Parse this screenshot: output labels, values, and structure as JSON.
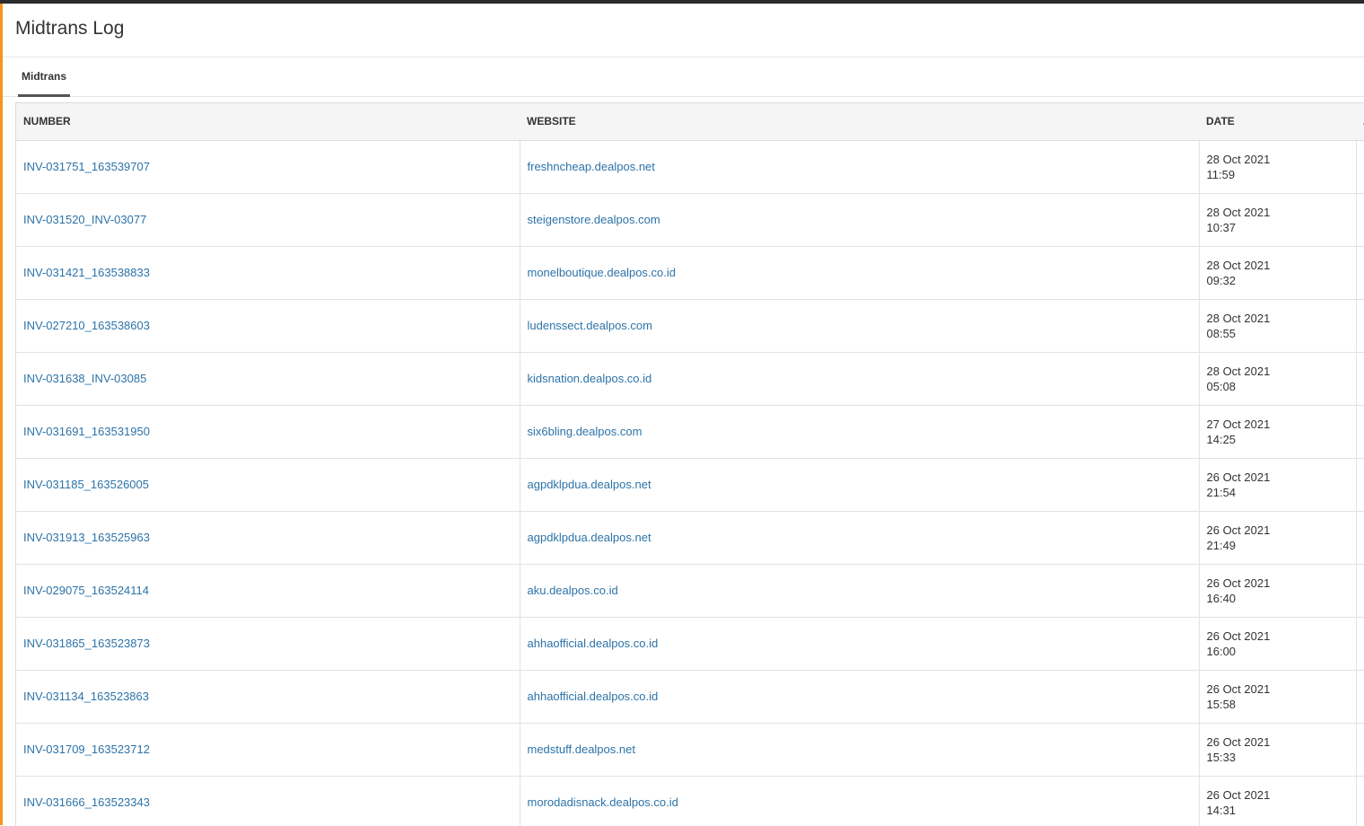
{
  "page": {
    "title": "Midtrans Log"
  },
  "tabs": [
    {
      "label": "Midtrans"
    }
  ],
  "table": {
    "headers": {
      "number": "NUMBER",
      "website": "WEBSITE",
      "date": "DATE",
      "extra": "A"
    },
    "rows": [
      {
        "number": "INV-031751_163539707",
        "website": "freshncheap.dealpos.net",
        "date": "28 Oct 2021",
        "time": "11:59"
      },
      {
        "number": "INV-031520_INV-03077",
        "website": "steigenstore.dealpos.com",
        "date": "28 Oct 2021",
        "time": "10:37"
      },
      {
        "number": "INV-031421_163538833",
        "website": "monelboutique.dealpos.co.id",
        "date": "28 Oct 2021",
        "time": "09:32"
      },
      {
        "number": "INV-027210_163538603",
        "website": "ludenssect.dealpos.com",
        "date": "28 Oct 2021",
        "time": "08:55"
      },
      {
        "number": "INV-031638_INV-03085",
        "website": "kidsnation.dealpos.co.id",
        "date": "28 Oct 2021",
        "time": "05:08"
      },
      {
        "number": "INV-031691_163531950",
        "website": "six6bling.dealpos.com",
        "date": "27 Oct 2021",
        "time": "14:25"
      },
      {
        "number": "INV-031185_163526005",
        "website": "agpdklpdua.dealpos.net",
        "date": "26 Oct 2021",
        "time": "21:54"
      },
      {
        "number": "INV-031913_163525963",
        "website": "agpdklpdua.dealpos.net",
        "date": "26 Oct 2021",
        "time": "21:49"
      },
      {
        "number": "INV-029075_163524114",
        "website": "aku.dealpos.co.id",
        "date": "26 Oct 2021",
        "time": "16:40"
      },
      {
        "number": "INV-031865_163523873",
        "website": "ahhaofficial.dealpos.co.id",
        "date": "26 Oct 2021",
        "time": "16:00"
      },
      {
        "number": "INV-031134_163523863",
        "website": "ahhaofficial.dealpos.co.id",
        "date": "26 Oct 2021",
        "time": "15:58"
      },
      {
        "number": "INV-031709_163523712",
        "website": "medstuff.dealpos.net",
        "date": "26 Oct 2021",
        "time": "15:33"
      },
      {
        "number": "INV-031666_163523343",
        "website": "morodadisnack.dealpos.co.id",
        "date": "26 Oct 2021",
        "time": "14:31"
      }
    ]
  },
  "colors": {
    "link": "#2d73a8",
    "accent": "#f7941d",
    "topbar": "#2b2b2b"
  }
}
